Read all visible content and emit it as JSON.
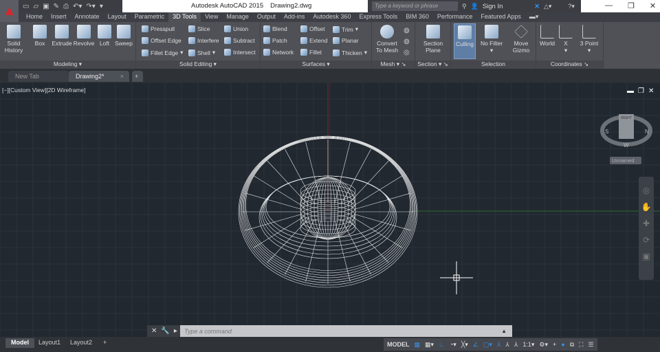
{
  "app": {
    "name": "Autodesk AutoCAD 2015",
    "document": "Drawing2.dwg",
    "logo": "A"
  },
  "search": {
    "placeholder": "Type a keyword or phrase"
  },
  "account": {
    "sign_in": "Sign In"
  },
  "window_controls": [
    "minimize-icon",
    "restore-icon",
    "close-icon"
  ],
  "ribbon_tabs": [
    "Home",
    "Insert",
    "Annotate",
    "Layout",
    "Parametric",
    "3D Tools",
    "View",
    "Manage",
    "Output",
    "Add-ins",
    "Autodesk 360",
    "Express Tools",
    "BIM 360",
    "Performance",
    "Featured Apps"
  ],
  "active_tab": "3D Tools",
  "panels": {
    "modeling": {
      "label": "Modeling",
      "solid_history": "Solid History",
      "box": "Box",
      "extrude": "Extrude",
      "revolve": "Revolve",
      "loft": "Loft",
      "sweep": "Sweep"
    },
    "solid_editing": {
      "label": "Solid Editing",
      "items": [
        "Presspull",
        "Offset Edge",
        "Fillet Edge",
        "Slice",
        "Interfere",
        "Shell",
        "Union",
        "Subtract",
        "Intersect"
      ]
    },
    "surfaces": {
      "label": "Surfaces",
      "items": [
        "Blend",
        "Patch",
        "Network",
        "Offset",
        "Extend",
        "Fillet",
        "Trim",
        "Planar",
        "Thicken"
      ]
    },
    "mesh": {
      "label": "Mesh",
      "convert": "Convert To Mesh"
    },
    "section": {
      "label": "Section",
      "plane": "Section Plane"
    },
    "selection": {
      "label": "Selection",
      "culling": "Culling",
      "no_filter": "No Filter",
      "move_gizmo": "Move Gizmo"
    },
    "coordinates": {
      "label": "Coordinates",
      "world": "World",
      "x": "X",
      "three_point": "3 Point"
    }
  },
  "doc_tabs": [
    "New Tab",
    "Drawing2*"
  ],
  "viewport": {
    "label": "[−][Custom View][2D Wireframe]",
    "viewcube": {
      "top": "RIGHT",
      "compass": [
        "S",
        "N",
        "W"
      ]
    },
    "ucs_name": "Unnamed"
  },
  "command": {
    "placeholder": "Type a command"
  },
  "layout_tabs": [
    "Model",
    "Layout1",
    "Layout2"
  ],
  "status": {
    "model": "MODEL",
    "scale": "1:1"
  },
  "colors": {
    "background": "#212830",
    "ribbon": "#4f5157",
    "accent": "#3b8fe0",
    "wireframe": "#ffffff",
    "axis_x": "#2f6b2f",
    "axis_y": "#7a2a2a"
  }
}
